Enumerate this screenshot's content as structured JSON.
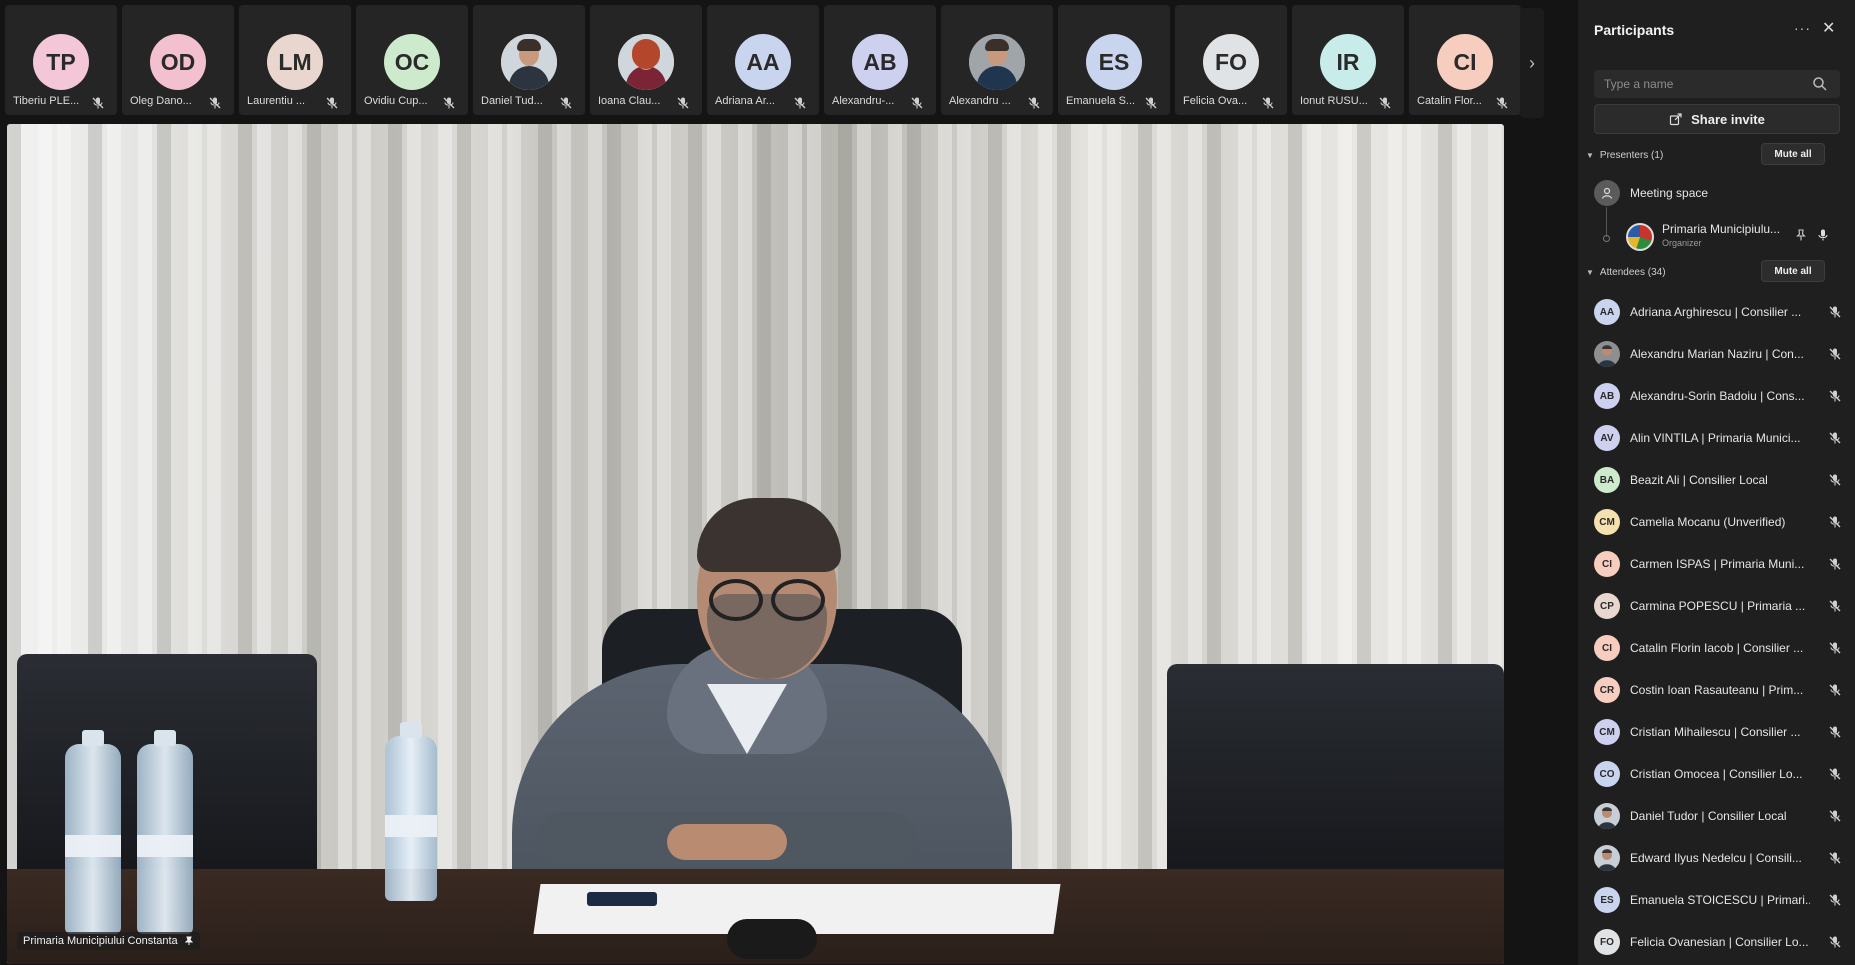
{
  "strip": {
    "tiles": [
      {
        "initials": "TP",
        "name": "Tiberiu PLE...",
        "color": "#f3c6d8",
        "kind": "initials"
      },
      {
        "initials": "OD",
        "name": "Oleg Dano...",
        "color": "#f3c0cf",
        "kind": "initials"
      },
      {
        "initials": "LM",
        "name": "Laurentiu ...",
        "color": "#e8d6cf",
        "kind": "initials"
      },
      {
        "initials": "OC",
        "name": "Ovidiu Cup...",
        "color": "#cdeacd",
        "kind": "initials"
      },
      {
        "initials": "",
        "name": "Daniel Tud...",
        "color": "#c8ced6",
        "kind": "photo-man"
      },
      {
        "initials": "",
        "name": "Ioana Clau...",
        "color": "#cfd6dc",
        "kind": "photo-woman"
      },
      {
        "initials": "AA",
        "name": "Adriana Ar...",
        "color": "#c9d4ef",
        "kind": "initials"
      },
      {
        "initials": "AB",
        "name": "Alexandru-...",
        "color": "#cdd0ef",
        "kind": "initials"
      },
      {
        "initials": "",
        "name": "Alexandru ...",
        "color": "#a0a5aa",
        "kind": "photo-man2"
      },
      {
        "initials": "ES",
        "name": "Emanuela S...",
        "color": "#c9d4ef",
        "kind": "initials"
      },
      {
        "initials": "FO",
        "name": "Felicia Ova...",
        "color": "#e0e3e6",
        "kind": "initials"
      },
      {
        "initials": "IR",
        "name": "Ionut RUSU...",
        "color": "#c8ecea",
        "kind": "initials"
      },
      {
        "initials": "CI",
        "name": "Catalin Flor...",
        "color": "#f6cdbf",
        "kind": "initials"
      }
    ],
    "next_icon": "chevron-right-icon"
  },
  "video": {
    "label": "Primaria Municipiului Constanta"
  },
  "panel": {
    "title": "Participants",
    "more_icon": "more-icon",
    "close_icon": "close-icon",
    "search_placeholder": "Type a name",
    "share_label": "Share invite",
    "presenters": {
      "label": "Presenters (1)",
      "mute_all": "Mute all",
      "meeting_space": "Meeting space",
      "organizer_name": "Primaria Municipiulu...",
      "organizer_role": "Organizer"
    },
    "attendees": {
      "label": "Attendees (34)",
      "mute_all": "Mute all",
      "items": [
        {
          "initials": "AA",
          "name": "Adriana Arghirescu | Consilier ...",
          "color": "#c9d4ef",
          "photo": false
        },
        {
          "initials": "",
          "name": "Alexandru Marian Naziru | Con...",
          "color": "#8d8f92",
          "photo": true
        },
        {
          "initials": "AB",
          "name": "Alexandru-Sorin Badoiu | Cons...",
          "color": "#cdd0ef",
          "photo": false
        },
        {
          "initials": "AV",
          "name": "Alin VINTILA | Primaria Munici...",
          "color": "#cdd0ef",
          "photo": false
        },
        {
          "initials": "BA",
          "name": "Beazit Ali | Consilier Local",
          "color": "#cdeacd",
          "photo": false
        },
        {
          "initials": "CM",
          "name": "Camelia Mocanu (Unverified)",
          "color": "#f5e0b0",
          "photo": false
        },
        {
          "initials": "CI",
          "name": "Carmen ISPAS | Primaria Muni...",
          "color": "#f6cdbf",
          "photo": false
        },
        {
          "initials": "CP",
          "name": "Carmina POPESCU | Primaria ...",
          "color": "#e8d6cf",
          "photo": false
        },
        {
          "initials": "CI",
          "name": "Catalin Florin Iacob | Consilier ...",
          "color": "#f6cdbf",
          "photo": false
        },
        {
          "initials": "CR",
          "name": "Costin Ioan Rasauteanu | Prim...",
          "color": "#f6cdbf",
          "photo": false
        },
        {
          "initials": "CM",
          "name": "Cristian Mihailescu | Consilier ...",
          "color": "#cdd0ef",
          "photo": false
        },
        {
          "initials": "CO",
          "name": "Cristian Omocea | Consilier Lo...",
          "color": "#c9d4ef",
          "photo": false
        },
        {
          "initials": "",
          "name": "Daniel Tudor | Consilier Local",
          "color": "#c8ced6",
          "photo": true
        },
        {
          "initials": "",
          "name": "Edward Ilyus Nedelcu | Consili...",
          "color": "#c8ced6",
          "photo": true
        },
        {
          "initials": "ES",
          "name": "Emanuela STOICESCU | Primari...",
          "color": "#c9d4ef",
          "photo": false
        },
        {
          "initials": "FO",
          "name": "Felicia Ovanesian | Consilier Lo...",
          "color": "#e0e3e6",
          "photo": false
        }
      ]
    }
  },
  "colors": {
    "panel_bg": "#1f1f1f",
    "tile_bg": "#252525",
    "app_bg": "#141414"
  }
}
